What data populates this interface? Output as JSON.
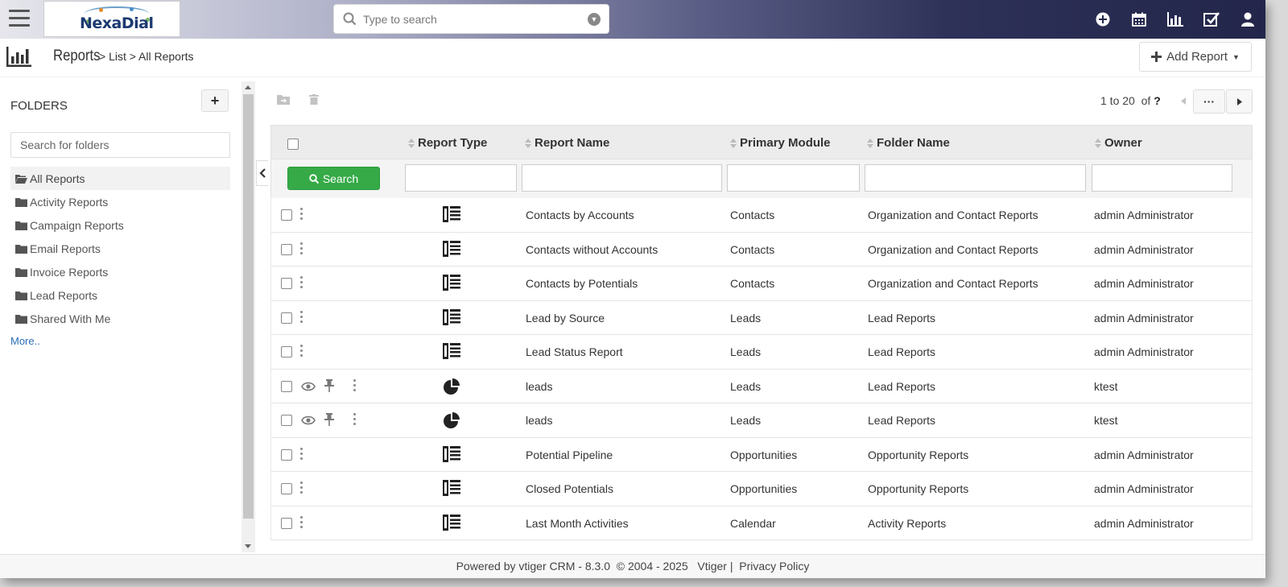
{
  "topbar": {
    "logo_text": "NexaDial",
    "search_placeholder": "Type to search",
    "icons": [
      "plus-circle-icon",
      "calendar-icon",
      "bar-chart-icon",
      "task-checkbox-icon",
      "user-icon"
    ]
  },
  "breadcrumb": {
    "module": "Reports",
    "rest": "> List > All Reports"
  },
  "add_report": {
    "label": "Add Report"
  },
  "sidebar": {
    "title": "FOLDERS",
    "search_placeholder": "Search for folders",
    "folders": [
      {
        "label": "All Reports"
      },
      {
        "label": "Activity Reports"
      },
      {
        "label": "Campaign Reports"
      },
      {
        "label": "Email Reports"
      },
      {
        "label": "Invoice Reports"
      },
      {
        "label": "Lead Reports"
      },
      {
        "label": "Shared With Me"
      }
    ],
    "more": "More.."
  },
  "pager": {
    "range": "1 to 20",
    "of": "of",
    "total": "?"
  },
  "table": {
    "search_label": "Search",
    "columns": [
      "Report Type",
      "Report Name",
      "Primary Module",
      "Folder Name",
      "Owner"
    ],
    "rows": [
      {
        "type": "detail",
        "name": "Contacts by Accounts",
        "module": "Contacts",
        "folder": "Organization and Contact Reports",
        "owner": "admin Administrator"
      },
      {
        "type": "detail",
        "name": "Contacts without Accounts",
        "module": "Contacts",
        "folder": "Organization and Contact Reports",
        "owner": "admin Administrator"
      },
      {
        "type": "detail",
        "name": "Contacts by Potentials",
        "module": "Contacts",
        "folder": "Organization and Contact Reports",
        "owner": "admin Administrator"
      },
      {
        "type": "detail",
        "name": "Lead by Source",
        "module": "Leads",
        "folder": "Lead Reports",
        "owner": "admin Administrator"
      },
      {
        "type": "detail",
        "name": "Lead Status Report",
        "module": "Leads",
        "folder": "Lead Reports",
        "owner": "admin Administrator"
      },
      {
        "type": "chart",
        "name": "leads",
        "module": "Leads",
        "folder": "Lead Reports",
        "owner": "ktest"
      },
      {
        "type": "chart",
        "name": "leads",
        "module": "Leads",
        "folder": "Lead Reports",
        "owner": "ktest"
      },
      {
        "type": "detail",
        "name": "Potential Pipeline",
        "module": "Opportunities",
        "folder": "Opportunity Reports",
        "owner": "admin Administrator"
      },
      {
        "type": "detail",
        "name": "Closed Potentials",
        "module": "Opportunities",
        "folder": "Opportunity Reports",
        "owner": "admin Administrator"
      },
      {
        "type": "detail",
        "name": "Last Month Activities",
        "module": "Calendar",
        "folder": "Activity Reports",
        "owner": "admin Administrator"
      }
    ]
  },
  "footer": {
    "powered": "Powered by vtiger CRM - 8.3.0",
    "copyright": "© 2004 - 2025",
    "vtiger": "Vtiger",
    "sep": "|",
    "privacy": "Privacy Policy"
  },
  "colors": {
    "accent_green": "#35aa47",
    "link_blue": "#2b6db5",
    "topbar_dark": "#23264a"
  }
}
